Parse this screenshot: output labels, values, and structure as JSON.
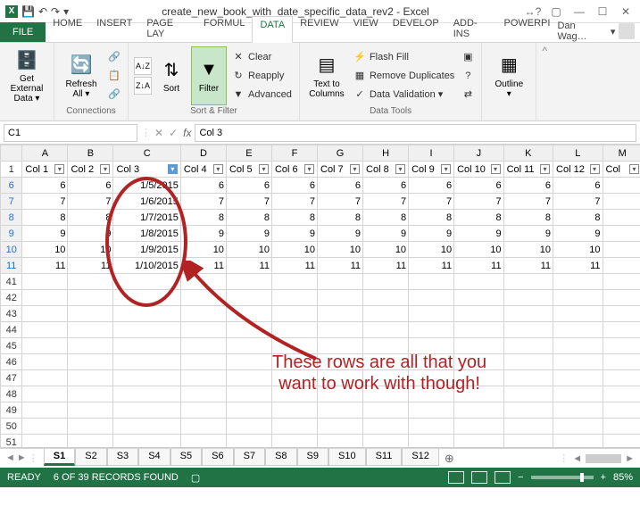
{
  "title": "create_new_book_with_date_specific_data_rev2 - Excel",
  "user": "Dan Wag…",
  "tabs": [
    "HOME",
    "INSERT",
    "PAGE LAY",
    "FORMUL",
    "DATA",
    "REVIEW",
    "VIEW",
    "DEVELOP",
    "ADD-INS",
    "POWERPI"
  ],
  "active_tab": "DATA",
  "ribbon": {
    "get_external": "Get External\nData ▾",
    "refresh": "Refresh\nAll ▾",
    "connections_group": "Connections",
    "sort": "Sort",
    "filter": "Filter",
    "clear": "Clear",
    "reapply": "Reapply",
    "advanced": "Advanced",
    "sortfilter_group": "Sort & Filter",
    "text_to_columns": "Text to\nColumns",
    "flash_fill": "Flash Fill",
    "remove_dup": "Remove Duplicates",
    "data_validation": "Data Validation  ▾",
    "datatools_group": "Data Tools",
    "outline": "Outline\n▾"
  },
  "namebox": "C1",
  "formula": "Col 3",
  "columns": [
    "A",
    "B",
    "C",
    "D",
    "E",
    "F",
    "G",
    "H",
    "I",
    "J",
    "K",
    "L",
    "M"
  ],
  "headers": [
    "Col 1",
    "Col 2",
    "Col 3",
    "Col 4",
    "Col 5",
    "Col 6",
    "Col 7",
    "Col 8",
    "Col 9",
    "Col 10",
    "Col 11",
    "Col 12",
    "Col"
  ],
  "filter_active_col": 2,
  "rows": [
    {
      "n": 6,
      "v": [
        6,
        6,
        "1/5/2015",
        6,
        6,
        6,
        6,
        6,
        6,
        6,
        6,
        6
      ]
    },
    {
      "n": 7,
      "v": [
        7,
        7,
        "1/6/2015",
        7,
        7,
        7,
        7,
        7,
        7,
        7,
        7,
        7
      ]
    },
    {
      "n": 8,
      "v": [
        8,
        8,
        "1/7/2015",
        8,
        8,
        8,
        8,
        8,
        8,
        8,
        8,
        8
      ]
    },
    {
      "n": 9,
      "v": [
        9,
        9,
        "1/8/2015",
        9,
        9,
        9,
        9,
        9,
        9,
        9,
        9,
        9
      ]
    },
    {
      "n": 10,
      "v": [
        10,
        10,
        "1/9/2015",
        10,
        10,
        10,
        10,
        10,
        10,
        10,
        10,
        10
      ]
    },
    {
      "n": 11,
      "v": [
        11,
        11,
        "1/10/2015",
        11,
        11,
        11,
        11,
        11,
        11,
        11,
        11,
        11
      ]
    }
  ],
  "empty_rows": [
    41,
    42,
    43,
    44,
    45,
    46,
    47,
    48,
    49,
    50,
    51
  ],
  "annotation": {
    "line1": "These rows are all that you",
    "line2": "want to work with though!"
  },
  "sheets": [
    "S1",
    "S2",
    "S3",
    "S4",
    "S5",
    "S6",
    "S7",
    "S8",
    "S9",
    "S10",
    "S11",
    "S12"
  ],
  "active_sheet": "S1",
  "status": {
    "ready": "READY",
    "found": "6 OF 39 RECORDS FOUND",
    "zoom": "85%"
  }
}
